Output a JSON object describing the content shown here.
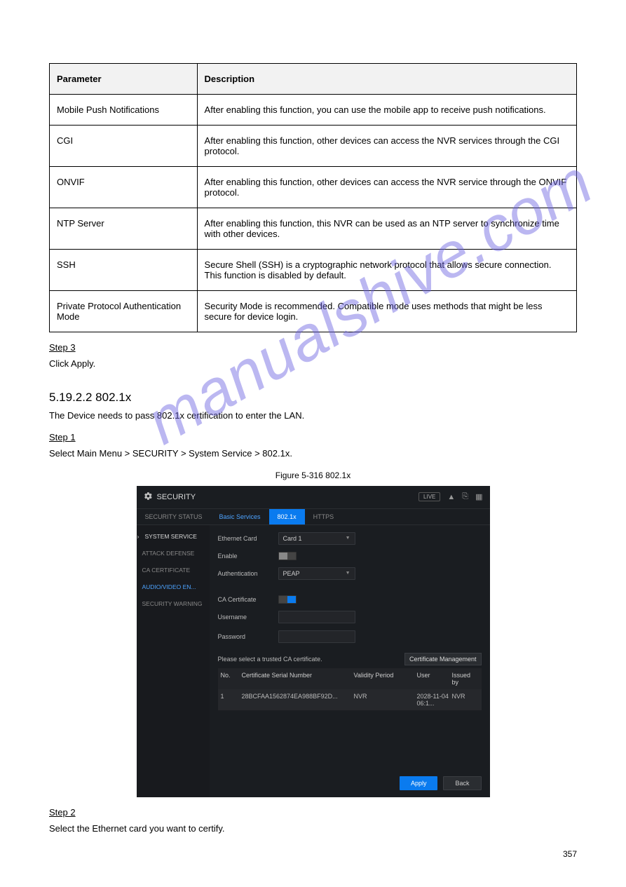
{
  "watermark": "manualshive.com",
  "param_table": {
    "headers": {
      "param": "Parameter",
      "desc": "Description"
    },
    "rows": [
      {
        "param": "Mobile Push Notifications",
        "desc": "After enabling this function, you can use the mobile app to receive push notifications."
      },
      {
        "param": "CGI",
        "desc": "After enabling this function, other devices can access the NVR services through the CGI protocol."
      },
      {
        "param": "ONVIF",
        "desc": "After enabling this function, other devices can access the NVR service through the ONVIF protocol."
      },
      {
        "param": "NTP Server",
        "desc": "After enabling this function, this NVR can be used as an NTP server to synchronize time with other devices."
      },
      {
        "param": "SSH",
        "desc": "Secure Shell (SSH) is a cryptographic network protocol that allows secure connection. This function is disabled by default."
      },
      {
        "param": "Private Protocol Authentication Mode",
        "desc": "Security Mode is recommended. Compatible mode uses methods that might be less secure for device login."
      }
    ]
  },
  "steps": {
    "step3_title": "Step 3",
    "step3_body": "Click Apply.",
    "section_title": "5.19.2.2 802.1x",
    "section_body": "The Device needs to pass 802.1x certification to enter the LAN.",
    "step1_title": "Step 1",
    "step1_body": "Select Main Menu > SECURITY > System Service > 802.1x.",
    "figure_caption": "Figure 5-316 802.1x",
    "step2_title": "Step 2",
    "step2_body": "Select the Ethernet card you want to certify."
  },
  "security_panel": {
    "title": "SECURITY",
    "live_badge": "LIVE",
    "tabs": {
      "status": "SECURITY STATUS",
      "basic": "Basic Services",
      "dotx": "802.1x",
      "https": "HTTPS"
    },
    "sidebar": {
      "system_service": "SYSTEM SERVICE",
      "attack_defense": "ATTACK DEFENSE",
      "ca_certificate": "CA CERTIFICATE",
      "audio_video": "AUDIO/VIDEO EN...",
      "security_warning": "SECURITY WARNING"
    },
    "form": {
      "ethernet_label": "Ethernet Card",
      "ethernet_value": "Card 1",
      "enable_label": "Enable",
      "auth_label": "Authentication",
      "auth_value": "PEAP",
      "ca_cert_label": "CA Certificate",
      "username_label": "Username",
      "password_label": "Password",
      "hint": "Please select a trusted CA certificate.",
      "cert_mgmt": "Certificate Management"
    },
    "cert_table": {
      "headers": {
        "no": "No.",
        "serial": "Certificate Serial Number",
        "validity": "Validity Period",
        "user": "User",
        "issued": "Issued by"
      },
      "row": {
        "no": "1",
        "serial": "28BCFAA1562874EA988BF92D...",
        "validity": "NVR",
        "user": "2028-11-04 06:1...",
        "issued": "NVR"
      }
    },
    "buttons": {
      "apply": "Apply",
      "back": "Back"
    }
  },
  "page_number": "357"
}
